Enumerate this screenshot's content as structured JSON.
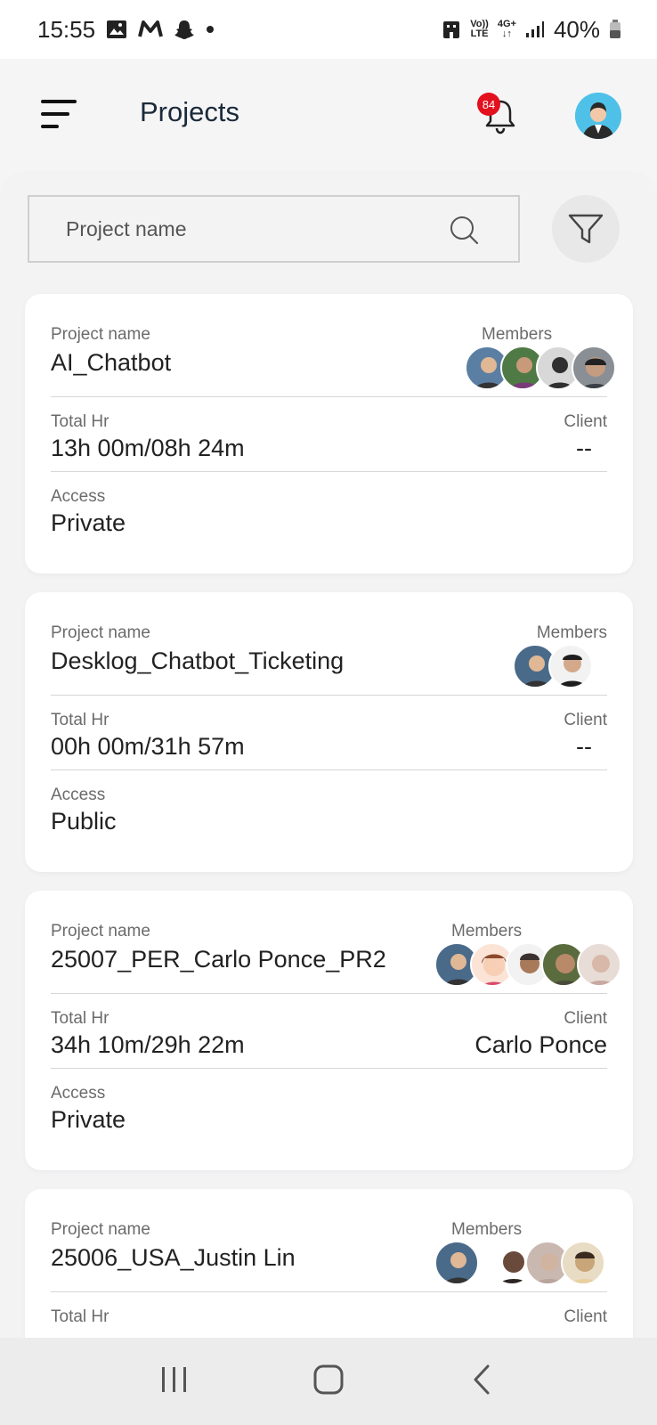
{
  "status_bar": {
    "time": "15:55",
    "battery": "40%",
    "volte_top": "Vo))",
    "volte_bottom": "LTE",
    "network": "4G+"
  },
  "header": {
    "title": "Projects",
    "notification_count": "84"
  },
  "search": {
    "placeholder": "Project name"
  },
  "labels": {
    "project_name": "Project name",
    "members": "Members",
    "total_hr": "Total Hr",
    "client": "Client",
    "access": "Access"
  },
  "projects": [
    {
      "name": "AI_Chatbot",
      "total_hr": "13h 00m/08h 24m",
      "client": "--",
      "access": "Private",
      "member_colors": [
        "#5b7fa3",
        "#4f7a45",
        "#2f2f2f",
        "#3a3f46"
      ]
    },
    {
      "name": "Desklog_Chatbot_Ticketing",
      "total_hr": "00h 00m/31h 57m",
      "client": "--",
      "access": "Public",
      "member_colors": [
        "#4a6a8a",
        "#1e1e1e"
      ]
    },
    {
      "name": "25007_PER_Carlo Ponce_PR2",
      "total_hr": "34h 10m/29h 22m",
      "client": "Carlo Ponce",
      "access": "Private",
      "member_colors": [
        "#4a6a8a",
        "#f0c4b0",
        "#3b3230",
        "#5a6b3e",
        "#d8c8c0"
      ]
    },
    {
      "name": "25006_USA_Justin Lin",
      "total_hr": "",
      "client": "",
      "access": "",
      "member_colors": [
        "#4a6a8a",
        "#2b2624",
        "#c9b8b0",
        "#c9a57a"
      ]
    }
  ],
  "colors": {
    "accent_badge": "#e3101e",
    "profile_bg": "#4fc1e8",
    "card_bg": "#ffffff",
    "page_bg": "#f3f3f4"
  }
}
